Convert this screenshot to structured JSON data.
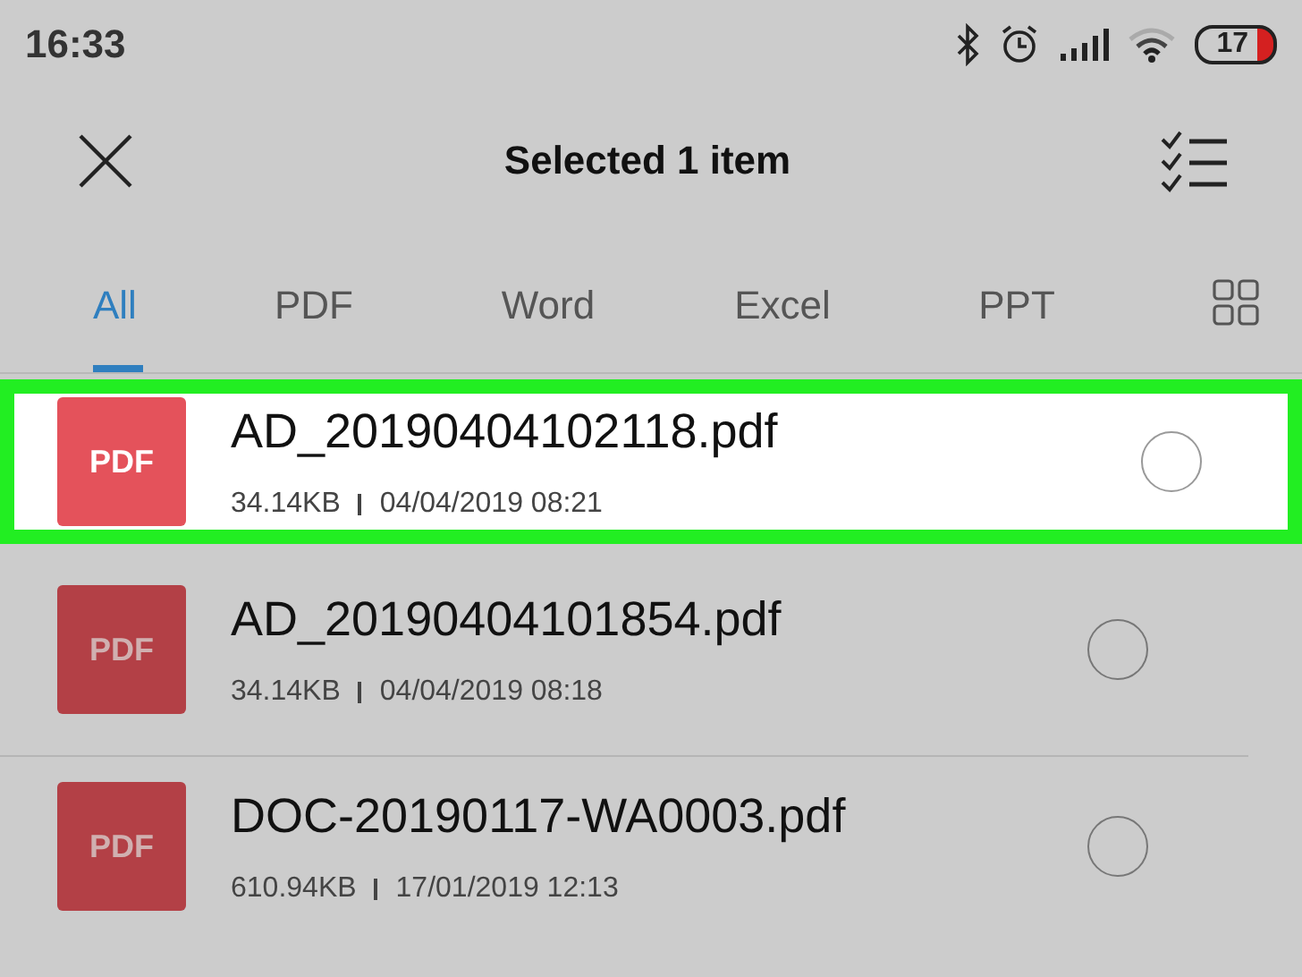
{
  "status_bar": {
    "time": "16:33",
    "battery": "17"
  },
  "toolbar": {
    "title": "Selected 1 item"
  },
  "tabs": [
    {
      "label": "All",
      "selected": true
    },
    {
      "label": "PDF",
      "selected": false
    },
    {
      "label": "Word",
      "selected": false
    },
    {
      "label": "Excel",
      "selected": false
    },
    {
      "label": "PPT",
      "selected": false
    }
  ],
  "files": [
    {
      "badge": "PDF",
      "name": "AD_20190404102118.pdf",
      "size": "34.14KB",
      "date": "04/04/2019 08:21",
      "highlighted": true,
      "checked": false
    },
    {
      "badge": "PDF",
      "name": "AD_20190404101854.pdf",
      "size": "34.14KB",
      "date": "04/04/2019 08:18",
      "highlighted": false,
      "checked": false
    },
    {
      "badge": "PDF",
      "name": "DOC-20190117-WA0003.pdf",
      "size": "610.94KB",
      "date": "17/01/2019 12:13",
      "highlighted": false,
      "checked": false
    }
  ]
}
